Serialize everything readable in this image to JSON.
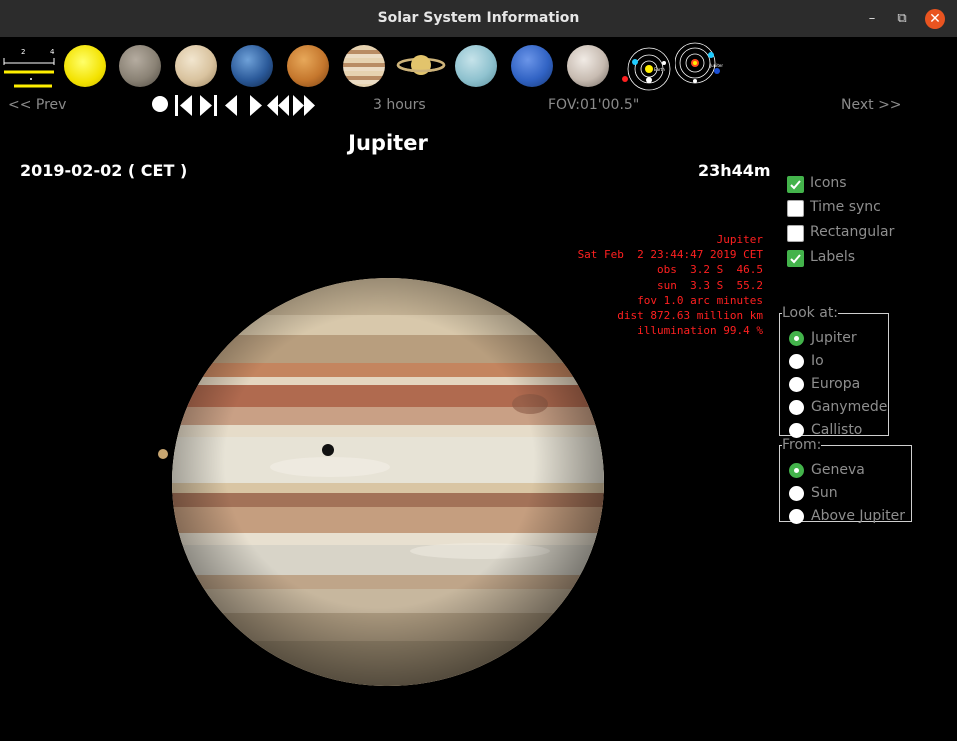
{
  "window": {
    "title": "Solar System Information",
    "minimize_glyph": "–",
    "maximize_glyph": "⧉",
    "close_glyph": "✕"
  },
  "toolbar": {
    "scale_labels": [
      "2",
      "4"
    ],
    "bodies": [
      "Sun",
      "Mercury",
      "Venus",
      "Earth",
      "Mars",
      "Jupiter",
      "Saturn",
      "Uranus",
      "Neptune",
      "Pluto",
      "Inner system orbits",
      "Outer system orbits"
    ],
    "orbit_small_label": "Earth",
    "orbit_large_label": "Jupiter"
  },
  "nav": {
    "prev_label": "<<  Prev",
    "next_label": "Next  >>",
    "step_label": "3 hours",
    "fov_label": "FOV:01'00.5\""
  },
  "view": {
    "planet_title": "Jupiter",
    "date": "2019-02-02   ( CET )",
    "time": "23h44m"
  },
  "info_lines": [
    "Jupiter",
    "Sat Feb  2 23:44:47 2019 CET",
    "obs  3.2 S  46.5",
    "sun  3.3 S  55.2",
    "fov 1.0 arc minutes",
    "dist 872.63 million km",
    "illumination 99.4 %"
  ],
  "options": {
    "icons": "Icons",
    "time_sync": "Time sync",
    "rectangular": "Rectangular",
    "labels": "Labels"
  },
  "look_at": {
    "legend": "Look at:",
    "items": [
      "Jupiter",
      "Io",
      "Europa",
      "Ganymede",
      "Callisto"
    ],
    "selected": "Jupiter"
  },
  "from": {
    "legend": "From:",
    "items": [
      "Geneva",
      "Sun",
      "Above Jupiter"
    ],
    "selected": "Geneva"
  },
  "colors": {
    "accent_green": "#43b34b",
    "info_red": "#ff2020",
    "close_orange": "#e95420"
  }
}
